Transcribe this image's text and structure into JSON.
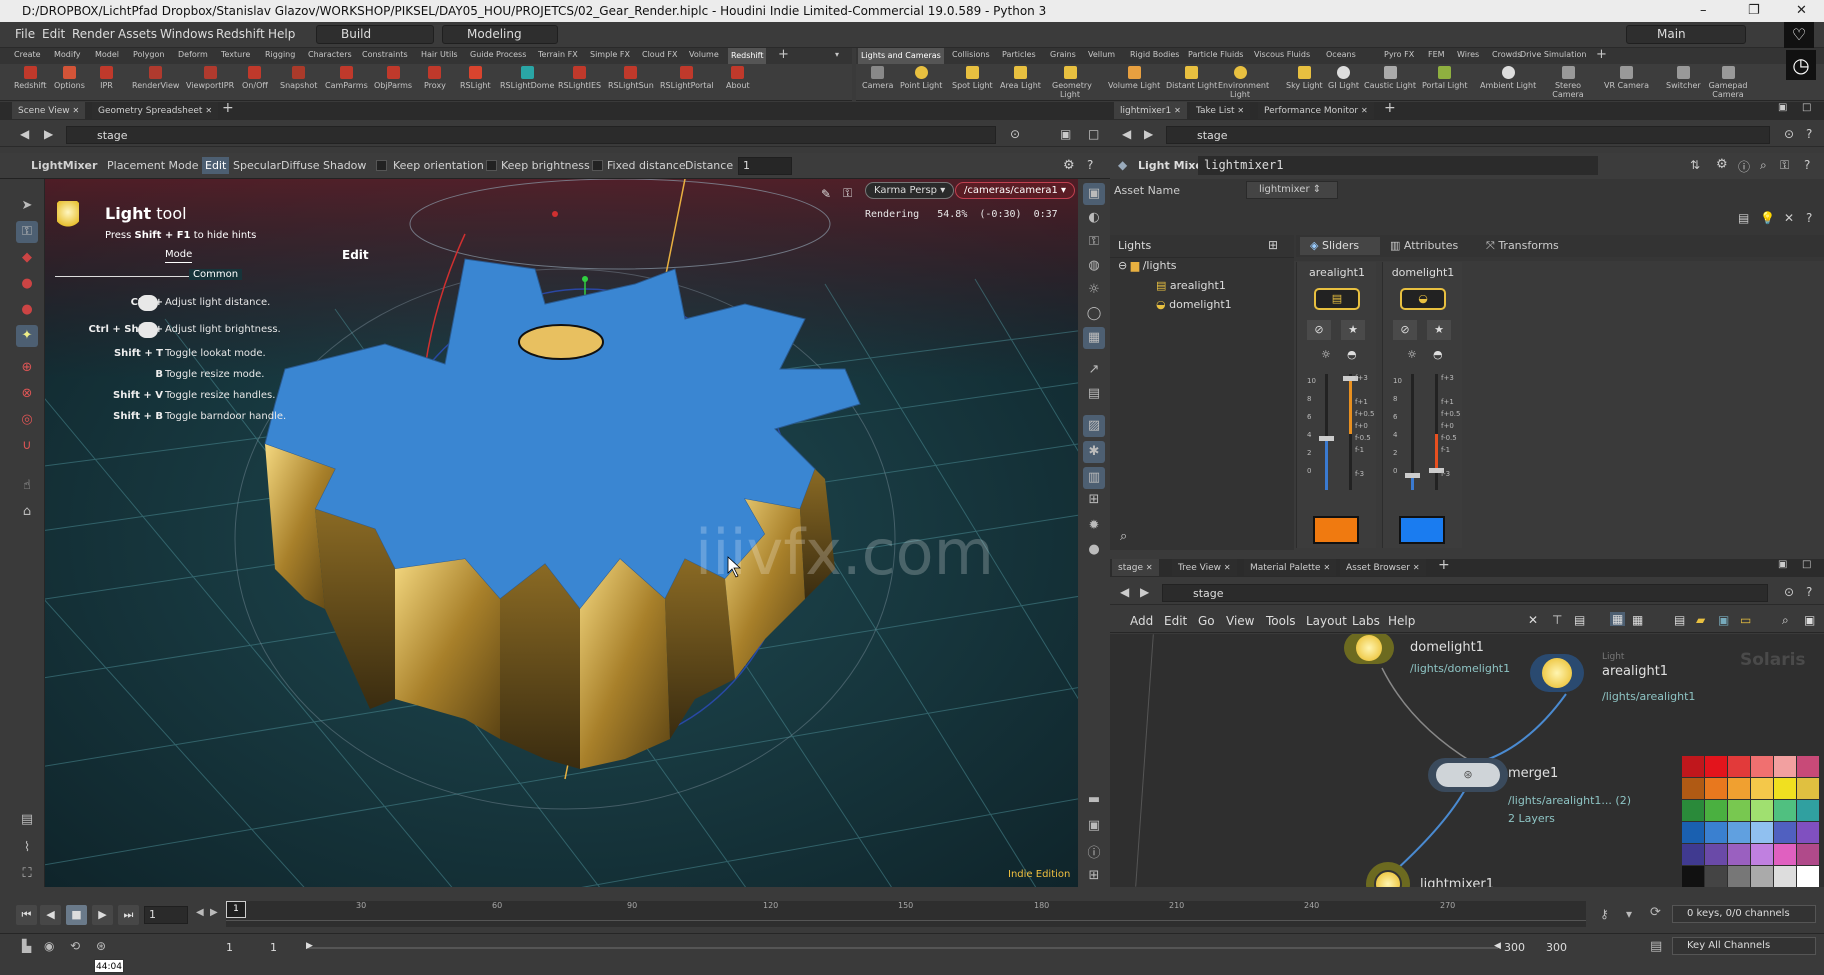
{
  "window": {
    "title": "D:/DROPBOX/LichtPfad Dropbox/Stanislav Glazov/WORKSHOP/PIKSEL/DAY05_HOU/PROJETCS/02_Gear_Render.hiplc - Houdini Indie Limited-Commercial 19.0.589 - Python 3"
  },
  "menubar": {
    "items": [
      "File",
      "Edit",
      "Render",
      "Assets",
      "Windows",
      "Redshift",
      "Help"
    ],
    "desktop": "Build",
    "context": "Modeling",
    "main": "Main"
  },
  "shelf_left": {
    "tabs": [
      "Create",
      "Modify",
      "Model",
      "Polygon",
      "Deform",
      "Texture",
      "Rigging",
      "Characters",
      "Constraints",
      "Hair Utils",
      "Guide Process",
      "Terrain FX",
      "Simple FX",
      "Cloud FX",
      "Volume",
      "Redshift"
    ],
    "active_tab": "Redshift",
    "tools": [
      "Redshift",
      "Options",
      "IPR",
      "RenderView",
      "ViewportIPR",
      "On/Off",
      "Snapshot",
      "CamParms",
      "ObjParms",
      "Proxy",
      "RSLight",
      "RSLightDome",
      "RSLightIES",
      "RSLightSun",
      "RSLightPortal",
      "About"
    ]
  },
  "shelf_right": {
    "tabs": [
      "Lights and Cameras",
      "Collisions",
      "Particles",
      "Grains",
      "Vellum",
      "Rigid Bodies",
      "Particle Fluids",
      "Viscous Fluids",
      "Oceans",
      "Pyro FX",
      "FEM",
      "Wires",
      "Crowds",
      "Drive Simulation"
    ],
    "tools": [
      "Camera",
      "Point Light",
      "Spot Light",
      "Area Light",
      "Geometry Light",
      "Volume Light",
      "Distant Light",
      "Environment Light",
      "Sky Light",
      "GI Light",
      "Caustic Light",
      "Portal Light",
      "Ambient Light",
      "Stereo Camera",
      "VR Camera",
      "Switcher",
      "Gamepad Camera"
    ]
  },
  "viewer": {
    "tabs": [
      "Scene View",
      "Geometry Spreadsheet"
    ],
    "path": "stage",
    "toolbar": {
      "tool_name": "LightMixer",
      "placement_mode": "Placement Mode",
      "modes": [
        "Edit",
        "Specular",
        "Diffuse",
        "Shadow"
      ],
      "active_mode": "Edit",
      "keep_orientation": "Keep orientation",
      "keep_brightness": "Keep brightness",
      "fixed_distance": "Fixed distance",
      "distance_label": "Distance",
      "distance_value": "1"
    },
    "renderer": "Karma",
    "persp": "Persp",
    "camera": "/cameras/camera1",
    "rendering": "Rendering   54.8%  (-0:30)  0:37",
    "edition": "Indie Edition",
    "watermark": "iiivfx.com"
  },
  "hints": {
    "title_bold": "Light",
    "title_rest": " tool",
    "subtitle_pre": "Press ",
    "subtitle_key": "Shift + F1",
    "subtitle_post": " to hide hints",
    "mode_label": "Mode",
    "mode_value": "Edit",
    "common": "Common",
    "rows": [
      {
        "key": "Ctrl +",
        "desc": "Adjust light distance."
      },
      {
        "key": "Ctrl + Shift +",
        "desc": "Adjust light brightness."
      },
      {
        "key": "Shift + T",
        "desc": "Toggle lookat mode."
      },
      {
        "key": "B",
        "desc": "Toggle resize mode."
      },
      {
        "key": "Shift + V",
        "desc": "Toggle resize handles."
      },
      {
        "key": "Shift + B",
        "desc": "Toggle barndoor handle."
      }
    ]
  },
  "params": {
    "tabs": [
      "lightmixer1",
      "Take List",
      "Performance Monitor"
    ],
    "path": "stage",
    "node_type": "Light Mixer",
    "node_name": "lightmixer1",
    "asset_name_label": "Asset Name",
    "asset_name_value": "lightmixer",
    "lights_label": "Lights",
    "tree": {
      "root": "/lights",
      "children": [
        "arealight1",
        "domelight1"
      ]
    },
    "subtabs": [
      "Sliders",
      "Attributes",
      "Transforms"
    ],
    "columns": [
      {
        "name": "arealight1",
        "color": "#f07a10"
      },
      {
        "name": "domelight1",
        "color": "#1a7cf0"
      }
    ],
    "scale_left": [
      "10",
      "8",
      "6",
      "4",
      "2",
      "0"
    ],
    "scale_right": [
      "f+3",
      "f+1",
      "f+0.5",
      "f+0",
      "f-0.5",
      "f-1",
      "f-3"
    ]
  },
  "network": {
    "tabs": [
      "stage",
      "Tree View",
      "Material Palette",
      "Asset Browser"
    ],
    "path": "stage",
    "menu": [
      "Add",
      "Edit",
      "Go",
      "View",
      "Tools",
      "Layout",
      "Labs",
      "Help"
    ],
    "context_label": "Solaris",
    "nodes": {
      "domelight": {
        "name": "domelight1",
        "path": "/lights/domelight1"
      },
      "arealight": {
        "name": "arealight1",
        "path": "/lights/arealight1",
        "tag": "Light"
      },
      "merge": {
        "name": "merge1",
        "path": "/lights/arealight1... (2)",
        "layers": "2 Layers"
      },
      "lightmixer": {
        "name": "lightmixer1"
      }
    },
    "palette": [
      "#c0171c",
      "#e3141c",
      "#e23a3a",
      "#f07070",
      "#f2a0a0",
      "#c84a78",
      "#b05a14",
      "#e8781e",
      "#f0a030",
      "#f4c84a",
      "#f0e020",
      "#e0c040",
      "#2a8a3a",
      "#4ab040",
      "#78c850",
      "#a0e070",
      "#50c080",
      "#30a0a0",
      "#1a60b0",
      "#3a80d0",
      "#60a0e0",
      "#90c0f0",
      "#5060c0",
      "#8050c0",
      "#403a90",
      "#6a4aa8",
      "#9a60c0",
      "#c080e0",
      "#e060c0",
      "#b04a8a",
      "#111111",
      "#444444",
      "#777777",
      "#aaaaaa",
      "#dddddd",
      "#ffffff"
    ]
  },
  "timeline": {
    "frame": "1",
    "ticks": [
      "1",
      "30",
      "60",
      "90",
      "120",
      "150",
      "180",
      "210",
      "240",
      "270"
    ],
    "start_a": "1",
    "start_b": "1",
    "end_a": "300",
    "end_b": "300",
    "keys": "0 keys, 0/0 channels",
    "key_all": "Key All Channels",
    "time": "44:04"
  }
}
